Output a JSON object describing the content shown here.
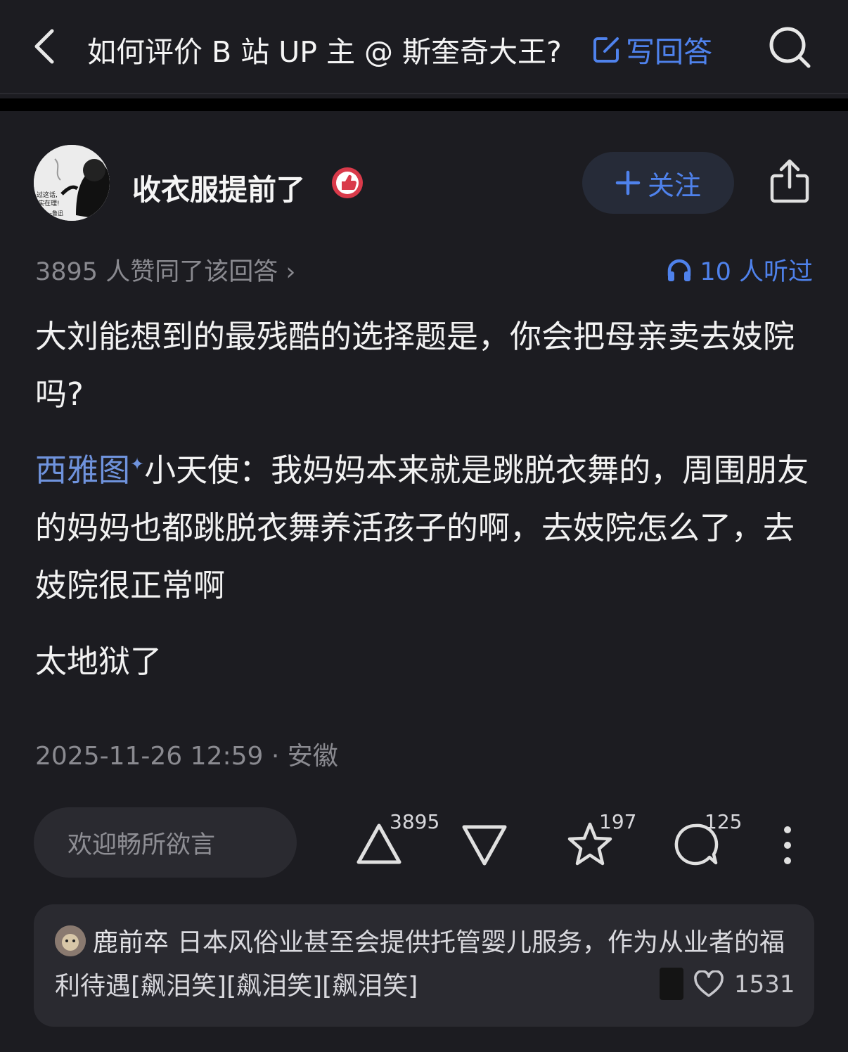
{
  "header": {
    "title": "如何评价 B 站 UP 主 @ 斯奎奇大王?",
    "write_answer_label": "写回答"
  },
  "author": {
    "name": "收衣服提前了",
    "avatar_caption_lines": [
      "过这话,",
      "实在理!",
      "——鲁迅"
    ],
    "follow_label": "关注"
  },
  "meta": {
    "upvote_summary": "3895 人赞同了该回答 ›",
    "listened": "10 人听过"
  },
  "answer": {
    "paragraph1": "大刘能想到的最残酷的选择题是，你会把母亲卖去妓院吗?",
    "mention_name": "西雅图",
    "mention_mark": "✦",
    "paragraph2_rest": "小天使：我妈妈本来就是跳脱衣舞的，周围朋友的妈妈也都跳脱衣舞养活孩子的啊，去妓院怎么了，去妓院很正常啊",
    "paragraph3": "太地狱了"
  },
  "datetime": "2025-11-26 12:59 · 安徽",
  "actions": {
    "comment_placeholder": "欢迎畅所欲言",
    "upvote_count": "3895",
    "favorite_count": "197",
    "comment_count": "125"
  },
  "hot_comment": {
    "author": "鹿前卒",
    "text": "日本风俗业甚至会提供托管婴儿服务，作为从业者的福利待遇[飙泪笑][飙泪笑][飙泪笑]",
    "likes": "1531"
  },
  "colors": {
    "background": "#1c1c21",
    "accent": "#4f82ec",
    "muted": "#8a8a90",
    "card": "#2a2a30"
  }
}
